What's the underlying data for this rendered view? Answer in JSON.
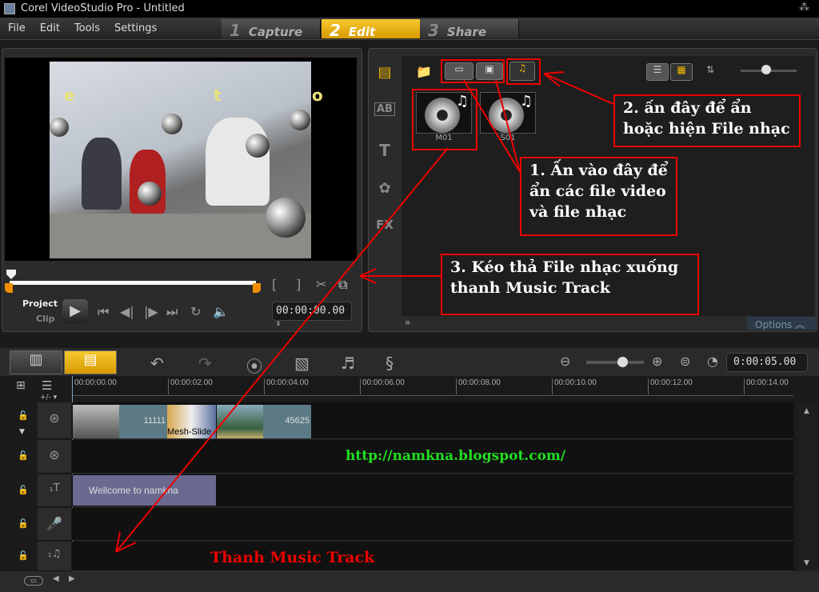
{
  "window": {
    "title": "Corel VideoStudio Pro - Untitled"
  },
  "menu": [
    "File",
    "Edit",
    "Tools",
    "Settings"
  ],
  "steps": [
    {
      "num": "1",
      "label": "Capture"
    },
    {
      "num": "2",
      "label": "Edit"
    },
    {
      "num": "3",
      "label": "Share"
    }
  ],
  "preview": {
    "overlay_letters": [
      "e",
      "t",
      "o"
    ],
    "project_label": "Project",
    "clip_label": "Clip",
    "mark_in": "[",
    "mark_out": "]",
    "timecode": "00:00:00.00"
  },
  "library": {
    "items": [
      {
        "label": "M01"
      },
      {
        "label": "S01"
      }
    ],
    "options_label": "Options",
    "side_tabs": [
      "AB",
      "T",
      "FX"
    ]
  },
  "timeline": {
    "timecode": "0:00:05.00",
    "ruler": [
      "00:00:00.00",
      "00:00:02.00",
      "00:00:04.00",
      "00:00:06.00",
      "00:00:08.00",
      "00:00:10.00",
      "00:00:12.00",
      "00:00:14.00"
    ],
    "add_remove": "+/- ▾",
    "clips": [
      {
        "label": "11111"
      },
      {
        "label": "Mesh-Slide"
      },
      {
        "label": "45625"
      }
    ],
    "title_clip": "Wellcome to namkna",
    "watermark": "http://namkna.blogspot.com/"
  },
  "annotations": {
    "note1": "1. Ấn vào đây để ẩn các file video và file nhạc",
    "note2": "2. ấn đây để ẩn hoặc hiện File nhạc",
    "note3": "3. Kéo thả File nhạc xuống thanh Music Track",
    "music_track": "Thanh Music Track"
  },
  "colors": {
    "accent": "#f0b800",
    "annotation": "#e00000",
    "watermark": "#22dd22"
  }
}
